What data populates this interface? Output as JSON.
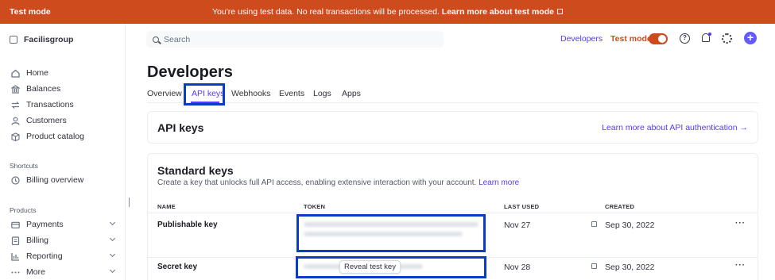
{
  "banner": {
    "mode": "Test mode",
    "message": "You're using test data. No real transactions will be processed.",
    "link": "Learn more about test mode"
  },
  "sidebar": {
    "account": "Facilisgroup",
    "items": [
      {
        "label": "Home",
        "icon": "home-icon"
      },
      {
        "label": "Balances",
        "icon": "bank-icon"
      },
      {
        "label": "Transactions",
        "icon": "arrows-icon"
      },
      {
        "label": "Customers",
        "icon": "person-icon"
      },
      {
        "label": "Product catalog",
        "icon": "box-icon"
      }
    ],
    "shortcuts_title": "Shortcuts",
    "shortcuts": [
      {
        "label": "Billing overview",
        "icon": "clock-icon"
      }
    ],
    "products_title": "Products",
    "products": [
      {
        "label": "Payments",
        "icon": "card-icon"
      },
      {
        "label": "Billing",
        "icon": "invoice-icon"
      },
      {
        "label": "Reporting",
        "icon": "chart-icon"
      },
      {
        "label": "More",
        "icon": "ellipsis-icon"
      }
    ]
  },
  "topbar": {
    "search_placeholder": "Search",
    "developers": "Developers",
    "test_mode": "Test mode",
    "test_mode_on": true
  },
  "page": {
    "title": "Developers",
    "tabs": [
      "Overview",
      "API keys",
      "Webhooks",
      "Events",
      "Logs",
      "Apps"
    ],
    "active_tab": "API keys"
  },
  "api_card": {
    "title": "API keys",
    "link": "Learn more about API authentication →"
  },
  "standard": {
    "title": "Standard keys",
    "description": "Create a key that unlocks full API access, enabling extensive interaction with your account.",
    "learn_more": "Learn more",
    "columns": [
      "NAME",
      "TOKEN",
      "LAST USED",
      "CREATED"
    ],
    "rows": [
      {
        "name": "Publishable key",
        "last_used": "Nov 27",
        "created": "Sep 30, 2022"
      },
      {
        "name": "Secret key",
        "last_used": "Nov 28",
        "created": "Sep 30, 2022",
        "reveal": "Reveal test key"
      }
    ]
  },
  "colors": {
    "accent": "#533afd",
    "banner": "#cd4b1c",
    "highlight": "#0a3cc4"
  }
}
